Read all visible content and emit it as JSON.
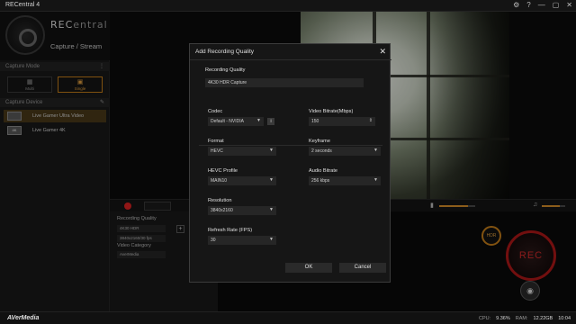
{
  "window": {
    "title": "RECentral 4",
    "controls": [
      "⚙",
      "?",
      "—",
      "▢",
      "✕"
    ]
  },
  "app": {
    "logo_main": "REC",
    "logo_accent": "entral",
    "mode_title": "Capture / Stream"
  },
  "sidebar": {
    "capture_mode_label": "Capture Mode",
    "modes": [
      {
        "label": "Multi"
      },
      {
        "label": "Single"
      }
    ],
    "capture_device_label": "Capture Device",
    "devices": [
      {
        "label": "Live Gamer Ultra Video"
      },
      {
        "label": "Live Gamer 4K"
      }
    ]
  },
  "bottom_panel": {
    "recording_quality_label": "Recording Quality",
    "quality_select": "4K30 HDR",
    "quality_select2": "3840x2160/30 fps",
    "video_category_label": "Video Category",
    "category_value": "AverMedia"
  },
  "rec": {
    "hdr": "HDR",
    "label": "REC"
  },
  "status": {
    "brand": "AVerMedia",
    "cpu_label": "CPU:",
    "cpu_value": "9.36%",
    "ram_label": "RAM:",
    "ram_value": "12.22GB",
    "time": "10:04"
  },
  "dialog": {
    "title": "Add Recording Quality",
    "recording_quality_label": "Recording Quality",
    "recording_quality_value": "4K30 HDR Capture",
    "codec_label": "Codec",
    "codec_value": "Default - NVIDIA",
    "video_bitrate_label": "Video Bitrate(Mbps)",
    "video_bitrate_value": "150",
    "format_label": "Format",
    "format_value": "HEVC",
    "keyframe_label": "Keyframe",
    "keyframe_value": "2 seconds",
    "hevc_profile_label": "HEVC Profile",
    "hevc_profile_value": "MAIN10",
    "audio_bitrate_label": "Audio Bitrate",
    "audio_bitrate_value": "256 kbps",
    "resolution_label": "Resolution",
    "resolution_value": "3840x2160",
    "refresh_label": "Refresh Rate (FPS)",
    "refresh_value": "30",
    "ok_label": "OK",
    "cancel_label": "Cancel"
  }
}
